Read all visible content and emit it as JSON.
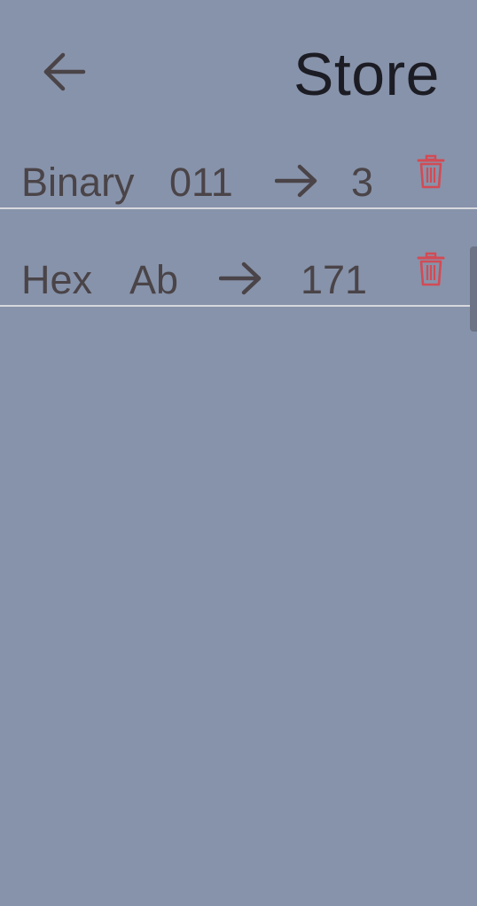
{
  "header": {
    "back_icon": "arrow-left-icon",
    "title": "Store"
  },
  "entries": [
    {
      "type": "Binary",
      "input": "011",
      "arrow_icon": "arrow-right-icon",
      "result": "3",
      "delete_icon": "trash-icon"
    },
    {
      "type": "Hex",
      "input": "Ab",
      "arrow_icon": "arrow-right-icon",
      "result": "171",
      "delete_icon": "trash-icon"
    }
  ],
  "colors": {
    "background": "#8793aa",
    "text": "#4a4448",
    "title": "#1c1c24",
    "delete": "#d24b55",
    "divider": "#d7d9de"
  }
}
